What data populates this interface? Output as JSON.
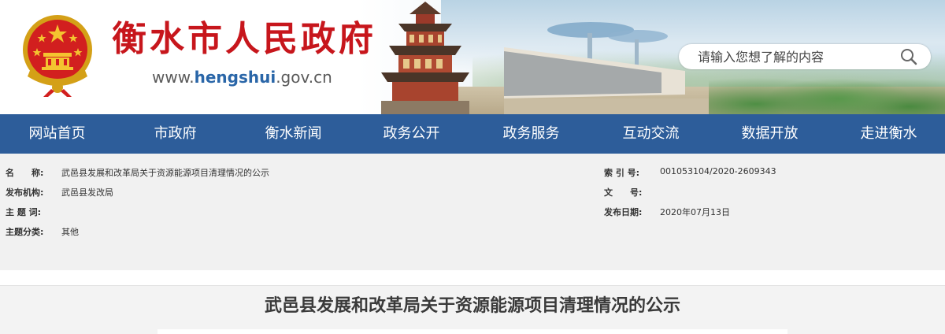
{
  "header": {
    "site_title": "衡水市人民政府",
    "url_prefix": "www.",
    "url_emphasis": "hengshui",
    "url_suffix": ".gov.cn",
    "search_placeholder": "请输入您想了解的内容",
    "colors": {
      "title_red": "#c7161c",
      "url_blue": "#2a66a8"
    }
  },
  "nav": {
    "background": "#2d5d9a",
    "items": [
      {
        "label": "网站首页"
      },
      {
        "label": "市政府"
      },
      {
        "label": "衡水新闻"
      },
      {
        "label": "政务公开"
      },
      {
        "label": "政务服务"
      },
      {
        "label": "互动交流"
      },
      {
        "label": "数据开放"
      },
      {
        "label": "走进衡水"
      }
    ]
  },
  "info": {
    "name_label": "名　　称:",
    "name_value": "武邑县发展和改革局关于资源能源项目清理情况的公示",
    "publisher_label": "发布机构:",
    "publisher_value": "武邑县发改局",
    "keywords_label": "主 题 词:",
    "keywords_value": "",
    "category_label": "主题分类:",
    "category_value": "其他",
    "index_label": "索 引 号:",
    "index_value": "001053104/2020-2609343",
    "doc_no_label": "文　　号:",
    "doc_no_value": "",
    "date_label": "发布日期:",
    "date_value": "2020年07月13日"
  },
  "article": {
    "title": "武邑县发展和改革局关于资源能源项目清理情况的公示"
  }
}
